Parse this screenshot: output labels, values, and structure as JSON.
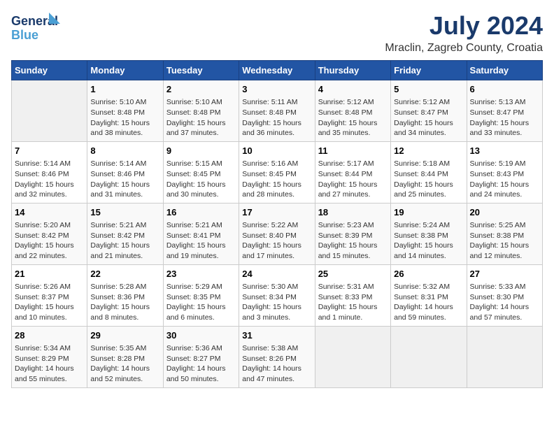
{
  "logo": {
    "line1": "General",
    "line2": "Blue"
  },
  "header": {
    "month": "July 2024",
    "location": "Mraclin, Zagreb County, Croatia"
  },
  "weekdays": [
    "Sunday",
    "Monday",
    "Tuesday",
    "Wednesday",
    "Thursday",
    "Friday",
    "Saturday"
  ],
  "weeks": [
    [
      {
        "day": "",
        "empty": true
      },
      {
        "day": "1",
        "sunrise": "Sunrise: 5:10 AM",
        "sunset": "Sunset: 8:48 PM",
        "daylight": "Daylight: 15 hours and 38 minutes."
      },
      {
        "day": "2",
        "sunrise": "Sunrise: 5:10 AM",
        "sunset": "Sunset: 8:48 PM",
        "daylight": "Daylight: 15 hours and 37 minutes."
      },
      {
        "day": "3",
        "sunrise": "Sunrise: 5:11 AM",
        "sunset": "Sunset: 8:48 PM",
        "daylight": "Daylight: 15 hours and 36 minutes."
      },
      {
        "day": "4",
        "sunrise": "Sunrise: 5:12 AM",
        "sunset": "Sunset: 8:48 PM",
        "daylight": "Daylight: 15 hours and 35 minutes."
      },
      {
        "day": "5",
        "sunrise": "Sunrise: 5:12 AM",
        "sunset": "Sunset: 8:47 PM",
        "daylight": "Daylight: 15 hours and 34 minutes."
      },
      {
        "day": "6",
        "sunrise": "Sunrise: 5:13 AM",
        "sunset": "Sunset: 8:47 PM",
        "daylight": "Daylight: 15 hours and 33 minutes."
      }
    ],
    [
      {
        "day": "7",
        "sunrise": "Sunrise: 5:14 AM",
        "sunset": "Sunset: 8:46 PM",
        "daylight": "Daylight: 15 hours and 32 minutes."
      },
      {
        "day": "8",
        "sunrise": "Sunrise: 5:14 AM",
        "sunset": "Sunset: 8:46 PM",
        "daylight": "Daylight: 15 hours and 31 minutes."
      },
      {
        "day": "9",
        "sunrise": "Sunrise: 5:15 AM",
        "sunset": "Sunset: 8:45 PM",
        "daylight": "Daylight: 15 hours and 30 minutes."
      },
      {
        "day": "10",
        "sunrise": "Sunrise: 5:16 AM",
        "sunset": "Sunset: 8:45 PM",
        "daylight": "Daylight: 15 hours and 28 minutes."
      },
      {
        "day": "11",
        "sunrise": "Sunrise: 5:17 AM",
        "sunset": "Sunset: 8:44 PM",
        "daylight": "Daylight: 15 hours and 27 minutes."
      },
      {
        "day": "12",
        "sunrise": "Sunrise: 5:18 AM",
        "sunset": "Sunset: 8:44 PM",
        "daylight": "Daylight: 15 hours and 25 minutes."
      },
      {
        "day": "13",
        "sunrise": "Sunrise: 5:19 AM",
        "sunset": "Sunset: 8:43 PM",
        "daylight": "Daylight: 15 hours and 24 minutes."
      }
    ],
    [
      {
        "day": "14",
        "sunrise": "Sunrise: 5:20 AM",
        "sunset": "Sunset: 8:42 PM",
        "daylight": "Daylight: 15 hours and 22 minutes."
      },
      {
        "day": "15",
        "sunrise": "Sunrise: 5:21 AM",
        "sunset": "Sunset: 8:42 PM",
        "daylight": "Daylight: 15 hours and 21 minutes."
      },
      {
        "day": "16",
        "sunrise": "Sunrise: 5:21 AM",
        "sunset": "Sunset: 8:41 PM",
        "daylight": "Daylight: 15 hours and 19 minutes."
      },
      {
        "day": "17",
        "sunrise": "Sunrise: 5:22 AM",
        "sunset": "Sunset: 8:40 PM",
        "daylight": "Daylight: 15 hours and 17 minutes."
      },
      {
        "day": "18",
        "sunrise": "Sunrise: 5:23 AM",
        "sunset": "Sunset: 8:39 PM",
        "daylight": "Daylight: 15 hours and 15 minutes."
      },
      {
        "day": "19",
        "sunrise": "Sunrise: 5:24 AM",
        "sunset": "Sunset: 8:38 PM",
        "daylight": "Daylight: 15 hours and 14 minutes."
      },
      {
        "day": "20",
        "sunrise": "Sunrise: 5:25 AM",
        "sunset": "Sunset: 8:38 PM",
        "daylight": "Daylight: 15 hours and 12 minutes."
      }
    ],
    [
      {
        "day": "21",
        "sunrise": "Sunrise: 5:26 AM",
        "sunset": "Sunset: 8:37 PM",
        "daylight": "Daylight: 15 hours and 10 minutes."
      },
      {
        "day": "22",
        "sunrise": "Sunrise: 5:28 AM",
        "sunset": "Sunset: 8:36 PM",
        "daylight": "Daylight: 15 hours and 8 minutes."
      },
      {
        "day": "23",
        "sunrise": "Sunrise: 5:29 AM",
        "sunset": "Sunset: 8:35 PM",
        "daylight": "Daylight: 15 hours and 6 minutes."
      },
      {
        "day": "24",
        "sunrise": "Sunrise: 5:30 AM",
        "sunset": "Sunset: 8:34 PM",
        "daylight": "Daylight: 15 hours and 3 minutes."
      },
      {
        "day": "25",
        "sunrise": "Sunrise: 5:31 AM",
        "sunset": "Sunset: 8:33 PM",
        "daylight": "Daylight: 15 hours and 1 minute."
      },
      {
        "day": "26",
        "sunrise": "Sunrise: 5:32 AM",
        "sunset": "Sunset: 8:31 PM",
        "daylight": "Daylight: 14 hours and 59 minutes."
      },
      {
        "day": "27",
        "sunrise": "Sunrise: 5:33 AM",
        "sunset": "Sunset: 8:30 PM",
        "daylight": "Daylight: 14 hours and 57 minutes."
      }
    ],
    [
      {
        "day": "28",
        "sunrise": "Sunrise: 5:34 AM",
        "sunset": "Sunset: 8:29 PM",
        "daylight": "Daylight: 14 hours and 55 minutes."
      },
      {
        "day": "29",
        "sunrise": "Sunrise: 5:35 AM",
        "sunset": "Sunset: 8:28 PM",
        "daylight": "Daylight: 14 hours and 52 minutes."
      },
      {
        "day": "30",
        "sunrise": "Sunrise: 5:36 AM",
        "sunset": "Sunset: 8:27 PM",
        "daylight": "Daylight: 14 hours and 50 minutes."
      },
      {
        "day": "31",
        "sunrise": "Sunrise: 5:38 AM",
        "sunset": "Sunset: 8:26 PM",
        "daylight": "Daylight: 14 hours and 47 minutes."
      },
      {
        "day": "",
        "empty": true
      },
      {
        "day": "",
        "empty": true
      },
      {
        "day": "",
        "empty": true
      }
    ]
  ]
}
